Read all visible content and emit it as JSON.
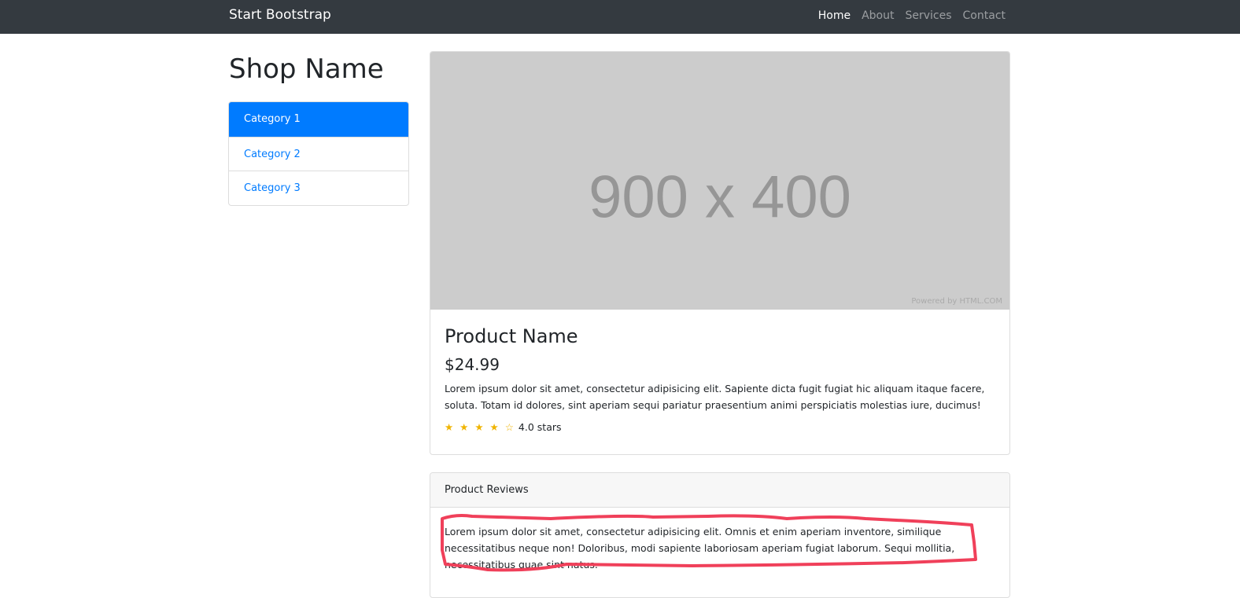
{
  "navbar": {
    "brand": "Start Bootstrap",
    "links": [
      "Home",
      "About",
      "Services",
      "Contact"
    ],
    "active": "Home"
  },
  "sidebar": {
    "title": "Shop Name",
    "categories": [
      "Category 1",
      "Category 2",
      "Category 3"
    ],
    "active": "Category 1"
  },
  "product": {
    "image_placeholder": "900 x 400",
    "image_credit": "Powered by HTML.COM",
    "name": "Product Name",
    "price": "$24.99",
    "description": "Lorem ipsum dolor sit amet, consectetur adipisicing elit. Sapiente dicta fugit fugiat hic aliquam itaque facere, soluta. Totam id dolores, sint aperiam sequi pariatur praesentium animi perspiciatis molestias iure, ducimus!",
    "stars": "★ ★ ★ ★ ☆",
    "rating": 4.0,
    "rating_text": "4.0 stars"
  },
  "reviews": {
    "header": "Product Reviews",
    "items": [
      "Lorem ipsum dolor sit amet, consectetur adipisicing elit. Omnis et enim aperiam inventore, similique necessitatibus neque non! Doloribus, modi sapiente laboriosam aperiam fugiat laborum. Sequi mollitia, necessitatibus quae sint natus."
    ]
  },
  "colors": {
    "navbar": "#343a40",
    "primary": "#007bff",
    "star": "#f0b400",
    "annotation": "#f0405a"
  }
}
